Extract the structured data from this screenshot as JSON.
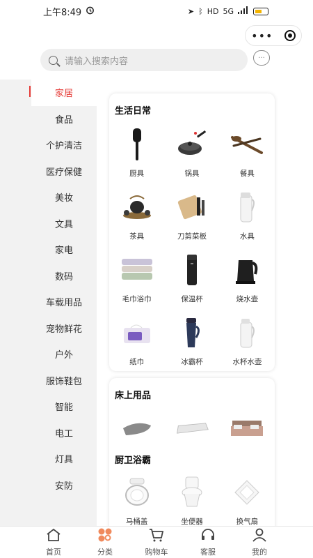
{
  "status_bar": {
    "time": "上午8:49",
    "alarm_icon": "alarm-clock-icon",
    "network": "5G",
    "hd": "HD"
  },
  "search": {
    "placeholder": "请输入搜索内容"
  },
  "sidebar": {
    "items": [
      {
        "label": "家居",
        "active": true
      },
      {
        "label": "食品"
      },
      {
        "label": "个护清洁"
      },
      {
        "label": "医疗保健"
      },
      {
        "label": "美妆"
      },
      {
        "label": "文具"
      },
      {
        "label": "家电"
      },
      {
        "label": "数码"
      },
      {
        "label": "车载用品"
      },
      {
        "label": "宠物鲜花"
      },
      {
        "label": "户外"
      },
      {
        "label": "服饰鞋包"
      },
      {
        "label": "智能"
      },
      {
        "label": "电工"
      },
      {
        "label": "灯具"
      },
      {
        "label": "安防"
      }
    ]
  },
  "sections": [
    {
      "title": "生活日常",
      "items": [
        {
          "label": "厨具",
          "icon": "spatula-icon"
        },
        {
          "label": "锅具",
          "icon": "pan-icon"
        },
        {
          "label": "餐具",
          "icon": "cutlery-icon"
        },
        {
          "label": "茶具",
          "icon": "tea-set-icon"
        },
        {
          "label": "刀剪菜板",
          "icon": "cutting-board-icon"
        },
        {
          "label": "水具",
          "icon": "water-jug-icon"
        },
        {
          "label": "毛巾浴巾",
          "icon": "towel-icon"
        },
        {
          "label": "保温杯",
          "icon": "thermos-icon"
        },
        {
          "label": "烧水壶",
          "icon": "kettle-icon"
        },
        {
          "label": "纸巾",
          "icon": "tissue-box-icon"
        },
        {
          "label": "冰霸杯",
          "icon": "tumbler-icon"
        },
        {
          "label": "水杯水壶",
          "icon": "water-pitcher-icon"
        }
      ]
    },
    {
      "title": "床上用品",
      "items": [
        {
          "label": "",
          "icon": "pillow-icon"
        },
        {
          "label": "",
          "icon": "mattress-icon"
        },
        {
          "label": "",
          "icon": "bed-icon"
        }
      ]
    },
    {
      "title": "厨卫浴霸",
      "items": [
        {
          "label": "马桶盖",
          "icon": "toilet-seat-icon"
        },
        {
          "label": "坐便器",
          "icon": "toilet-icon"
        },
        {
          "label": "换气扇",
          "icon": "vent-fan-icon"
        }
      ]
    }
  ],
  "bottom_nav": [
    {
      "label": "首页",
      "icon": "home-icon"
    },
    {
      "label": "分类",
      "icon": "category-icon",
      "active": true
    },
    {
      "label": "购物车",
      "icon": "cart-icon"
    },
    {
      "label": "客服",
      "icon": "headset-icon"
    },
    {
      "label": "我的",
      "icon": "user-icon"
    }
  ],
  "colors": {
    "accent": "#e53935",
    "category_icon": "#f08a5d"
  }
}
